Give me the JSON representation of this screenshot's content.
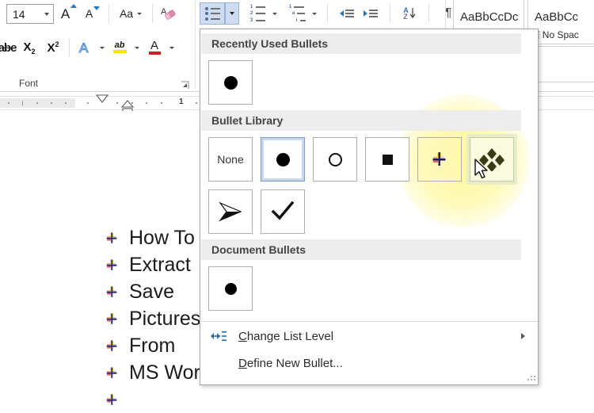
{
  "ribbon": {
    "font_group": {
      "label": "Font",
      "font_size_value": "14",
      "grow_font": "Grow Font",
      "shrink_font": "Shrink Font",
      "change_case": "Aa",
      "clear_formatting": "Clear All Formatting",
      "strikethrough": "abe",
      "subscript": "X",
      "subscript_sub": "2",
      "superscript": "X",
      "superscript_sup": "2",
      "text_effects": "A",
      "highlight": "ab",
      "font_color": "A",
      "dialog_launcher": "Font dialog launcher"
    },
    "paragraph_group": {
      "bullets": "Bullets",
      "numbering": "Numbering",
      "multilevel": "Multilevel List",
      "decrease_indent": "Decrease Indent",
      "increase_indent": "Increase Indent",
      "sort": "Sort",
      "sort_a": "A",
      "sort_z": "Z",
      "show_marks": "¶"
    },
    "styles_group": {
      "style1_sample": "AaBbCcDc",
      "style2_sample": "AaBbCc",
      "style2_name": "¶ No Spac"
    }
  },
  "ruler": {
    "number_1": "1"
  },
  "document": {
    "items": [
      {
        "text": "How To"
      },
      {
        "text": "Extract"
      },
      {
        "text": "Save"
      },
      {
        "text": "Pictures"
      },
      {
        "text": "From"
      },
      {
        "text": "MS Word"
      }
    ]
  },
  "bullet_panel": {
    "sections": {
      "recently_used": "Recently Used Bullets",
      "bullet_library": "Bullet Library",
      "document_bullets": "Document Bullets"
    },
    "recently_used_items": [
      {
        "name": "filled-circle-bullet",
        "glyph": "●"
      }
    ],
    "library_items": [
      {
        "name": "none",
        "label": "None"
      },
      {
        "name": "filled-circle-bullet",
        "label": "",
        "selected": true
      },
      {
        "name": "hollow-circle-bullet",
        "label": ""
      },
      {
        "name": "filled-square-bullet",
        "label": ""
      },
      {
        "name": "picture-cross-bullet",
        "label": ""
      },
      {
        "name": "diamond-cluster-bullet",
        "label": "",
        "hovered": true
      },
      {
        "name": "arrowhead-bullet",
        "label": ""
      },
      {
        "name": "checkmark-bullet",
        "label": ""
      }
    ],
    "document_items": [
      {
        "name": "filled-circle-bullet",
        "glyph": "●"
      }
    ],
    "menu": [
      {
        "name": "change-list-level",
        "prefix": "C",
        "rest": "hange List Level",
        "has_submenu": true
      },
      {
        "name": "define-new-bullet",
        "prefix": "D",
        "rest": "efine New Bullet...",
        "has_submenu": false
      }
    ]
  },
  "colors": {
    "accent_blue": "#2e75b6",
    "selected_border": "#7f9dc4",
    "selected_fill": "#c7d7ee",
    "hover_yellow": "#fbfbe2",
    "section_header_bg": "#ededed",
    "highlight_glow": "#fff79a"
  }
}
